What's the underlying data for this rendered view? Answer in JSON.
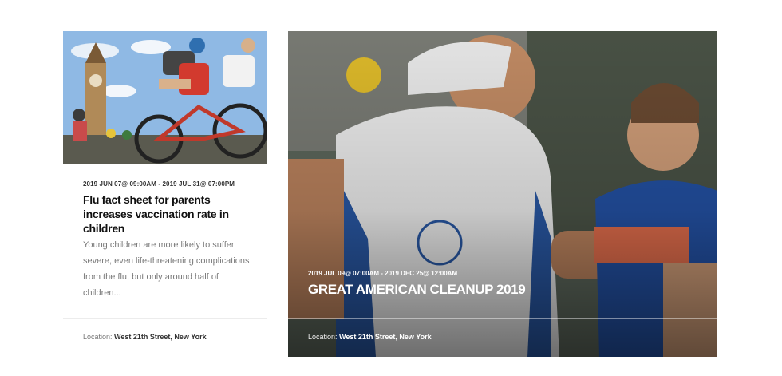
{
  "events": [
    {
      "date": "2019 JUN 07@ 09:00AM - 2019 JUL 31@ 07:00PM",
      "title": "Flu fact sheet for parents increases vaccination rate in children",
      "excerpt": "Young children are more likely to suffer severe, even life-threatening complications from the flu, but only around half of children...",
      "location_label": "Location:",
      "location_value": "West 21th Street, New York"
    },
    {
      "date": "2019 JUL 09@ 07:00AM - 2019 DEC 25@ 12:00AM",
      "title": "GREAT AMERICAN CLEANUP 2019",
      "location_label": "Location:",
      "location_value": "West 21th Street, New York"
    }
  ]
}
